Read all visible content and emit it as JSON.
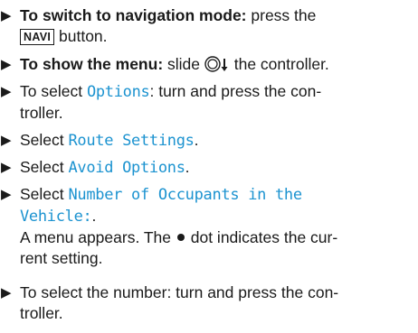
{
  "marker_glyph": "▶",
  "steps": [
    {
      "label": "To switch to navigation mode:",
      "text1": " press the",
      "button": "NAVI",
      "text2": " button."
    },
    {
      "label": "To show the menu:",
      "text1": " slide ",
      "text2": " the controller.",
      "icon": "controller-slide-down-icon"
    },
    {
      "text1": "To select ",
      "menu": "Options",
      "text2": ": turn and press the con-",
      "text3": "troller."
    },
    {
      "text1": "Select ",
      "menu": "Route Settings",
      "text2": "."
    },
    {
      "text1": "Select ",
      "menu": "Avoid Options",
      "text2": "."
    },
    {
      "text1": "Select ",
      "menu_line1": "Number of Occupants in the",
      "menu_line2": "Vehicle:",
      "text2": ".",
      "note1": "A menu appears. The ",
      "note2": " dot indicates the cur-",
      "note3": "rent setting."
    },
    {
      "text1": "To select the number: turn and press the con-",
      "text2": "troller."
    }
  ],
  "colors": {
    "menu_text": "#1c93d0",
    "body_text": "#1a1a1a"
  }
}
